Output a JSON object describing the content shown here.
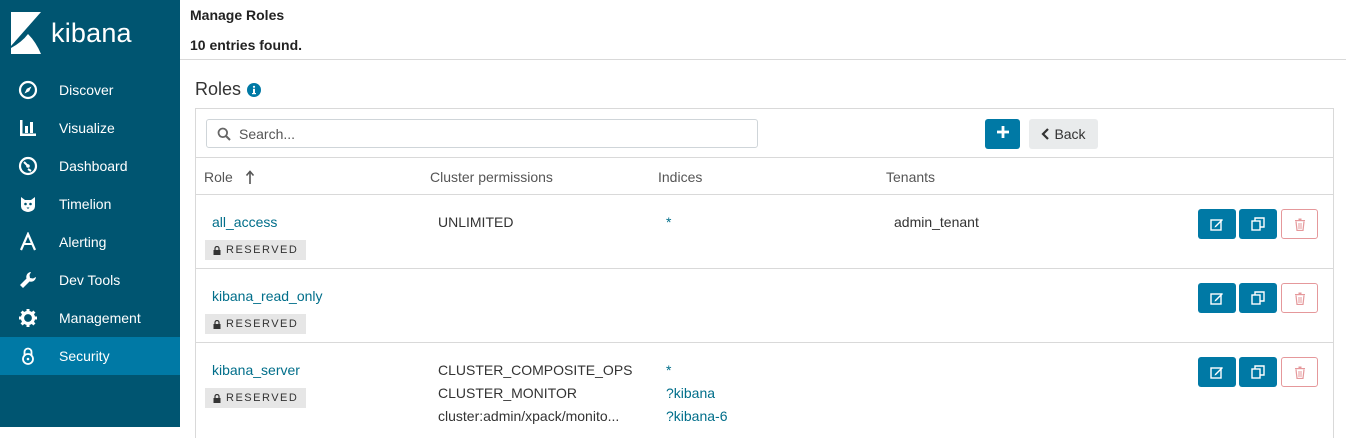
{
  "app": {
    "logo_text": "kibana"
  },
  "sidebar": {
    "items": [
      {
        "label": "Discover",
        "icon": "compass-icon"
      },
      {
        "label": "Visualize",
        "icon": "bar-chart-icon"
      },
      {
        "label": "Dashboard",
        "icon": "dashboard-icon"
      },
      {
        "label": "Timelion",
        "icon": "timelion-icon"
      },
      {
        "label": "Alerting",
        "icon": "alerting-icon"
      },
      {
        "label": "Dev Tools",
        "icon": "wrench-icon"
      },
      {
        "label": "Management",
        "icon": "gear-icon"
      },
      {
        "label": "Security",
        "icon": "lock-icon",
        "active": true
      }
    ]
  },
  "header": {
    "title": "Manage Roles",
    "entries": "10 entries found."
  },
  "section": {
    "title": "Roles"
  },
  "search": {
    "placeholder": "Search...",
    "value": ""
  },
  "toolbar": {
    "add_label": "+",
    "back_label": "Back"
  },
  "table": {
    "headers": {
      "role": "Role",
      "cluster": "Cluster permissions",
      "indices": "Indices",
      "tenants": "Tenants"
    },
    "sort": "ascending",
    "reserved_label": "RESERVED",
    "rows": [
      {
        "role": "all_access",
        "reserved": true,
        "cluster": [
          "UNLIMITED"
        ],
        "indices": [
          "*"
        ],
        "tenants": [
          "admin_tenant"
        ]
      },
      {
        "role": "kibana_read_only",
        "reserved": true,
        "cluster": [],
        "indices": [],
        "tenants": []
      },
      {
        "role": "kibana_server",
        "reserved": true,
        "cluster": [
          "CLUSTER_COMPOSITE_OPS",
          "CLUSTER_MONITOR",
          "cluster:admin/xpack/monito..."
        ],
        "indices": [
          "*",
          "?kibana",
          "?kibana-6"
        ],
        "tenants": []
      }
    ]
  },
  "colors": {
    "sidebar": "#005571",
    "active": "#0079a5",
    "primary": "#0079a5",
    "link": "#006e8a",
    "danger": "#d9534f"
  }
}
